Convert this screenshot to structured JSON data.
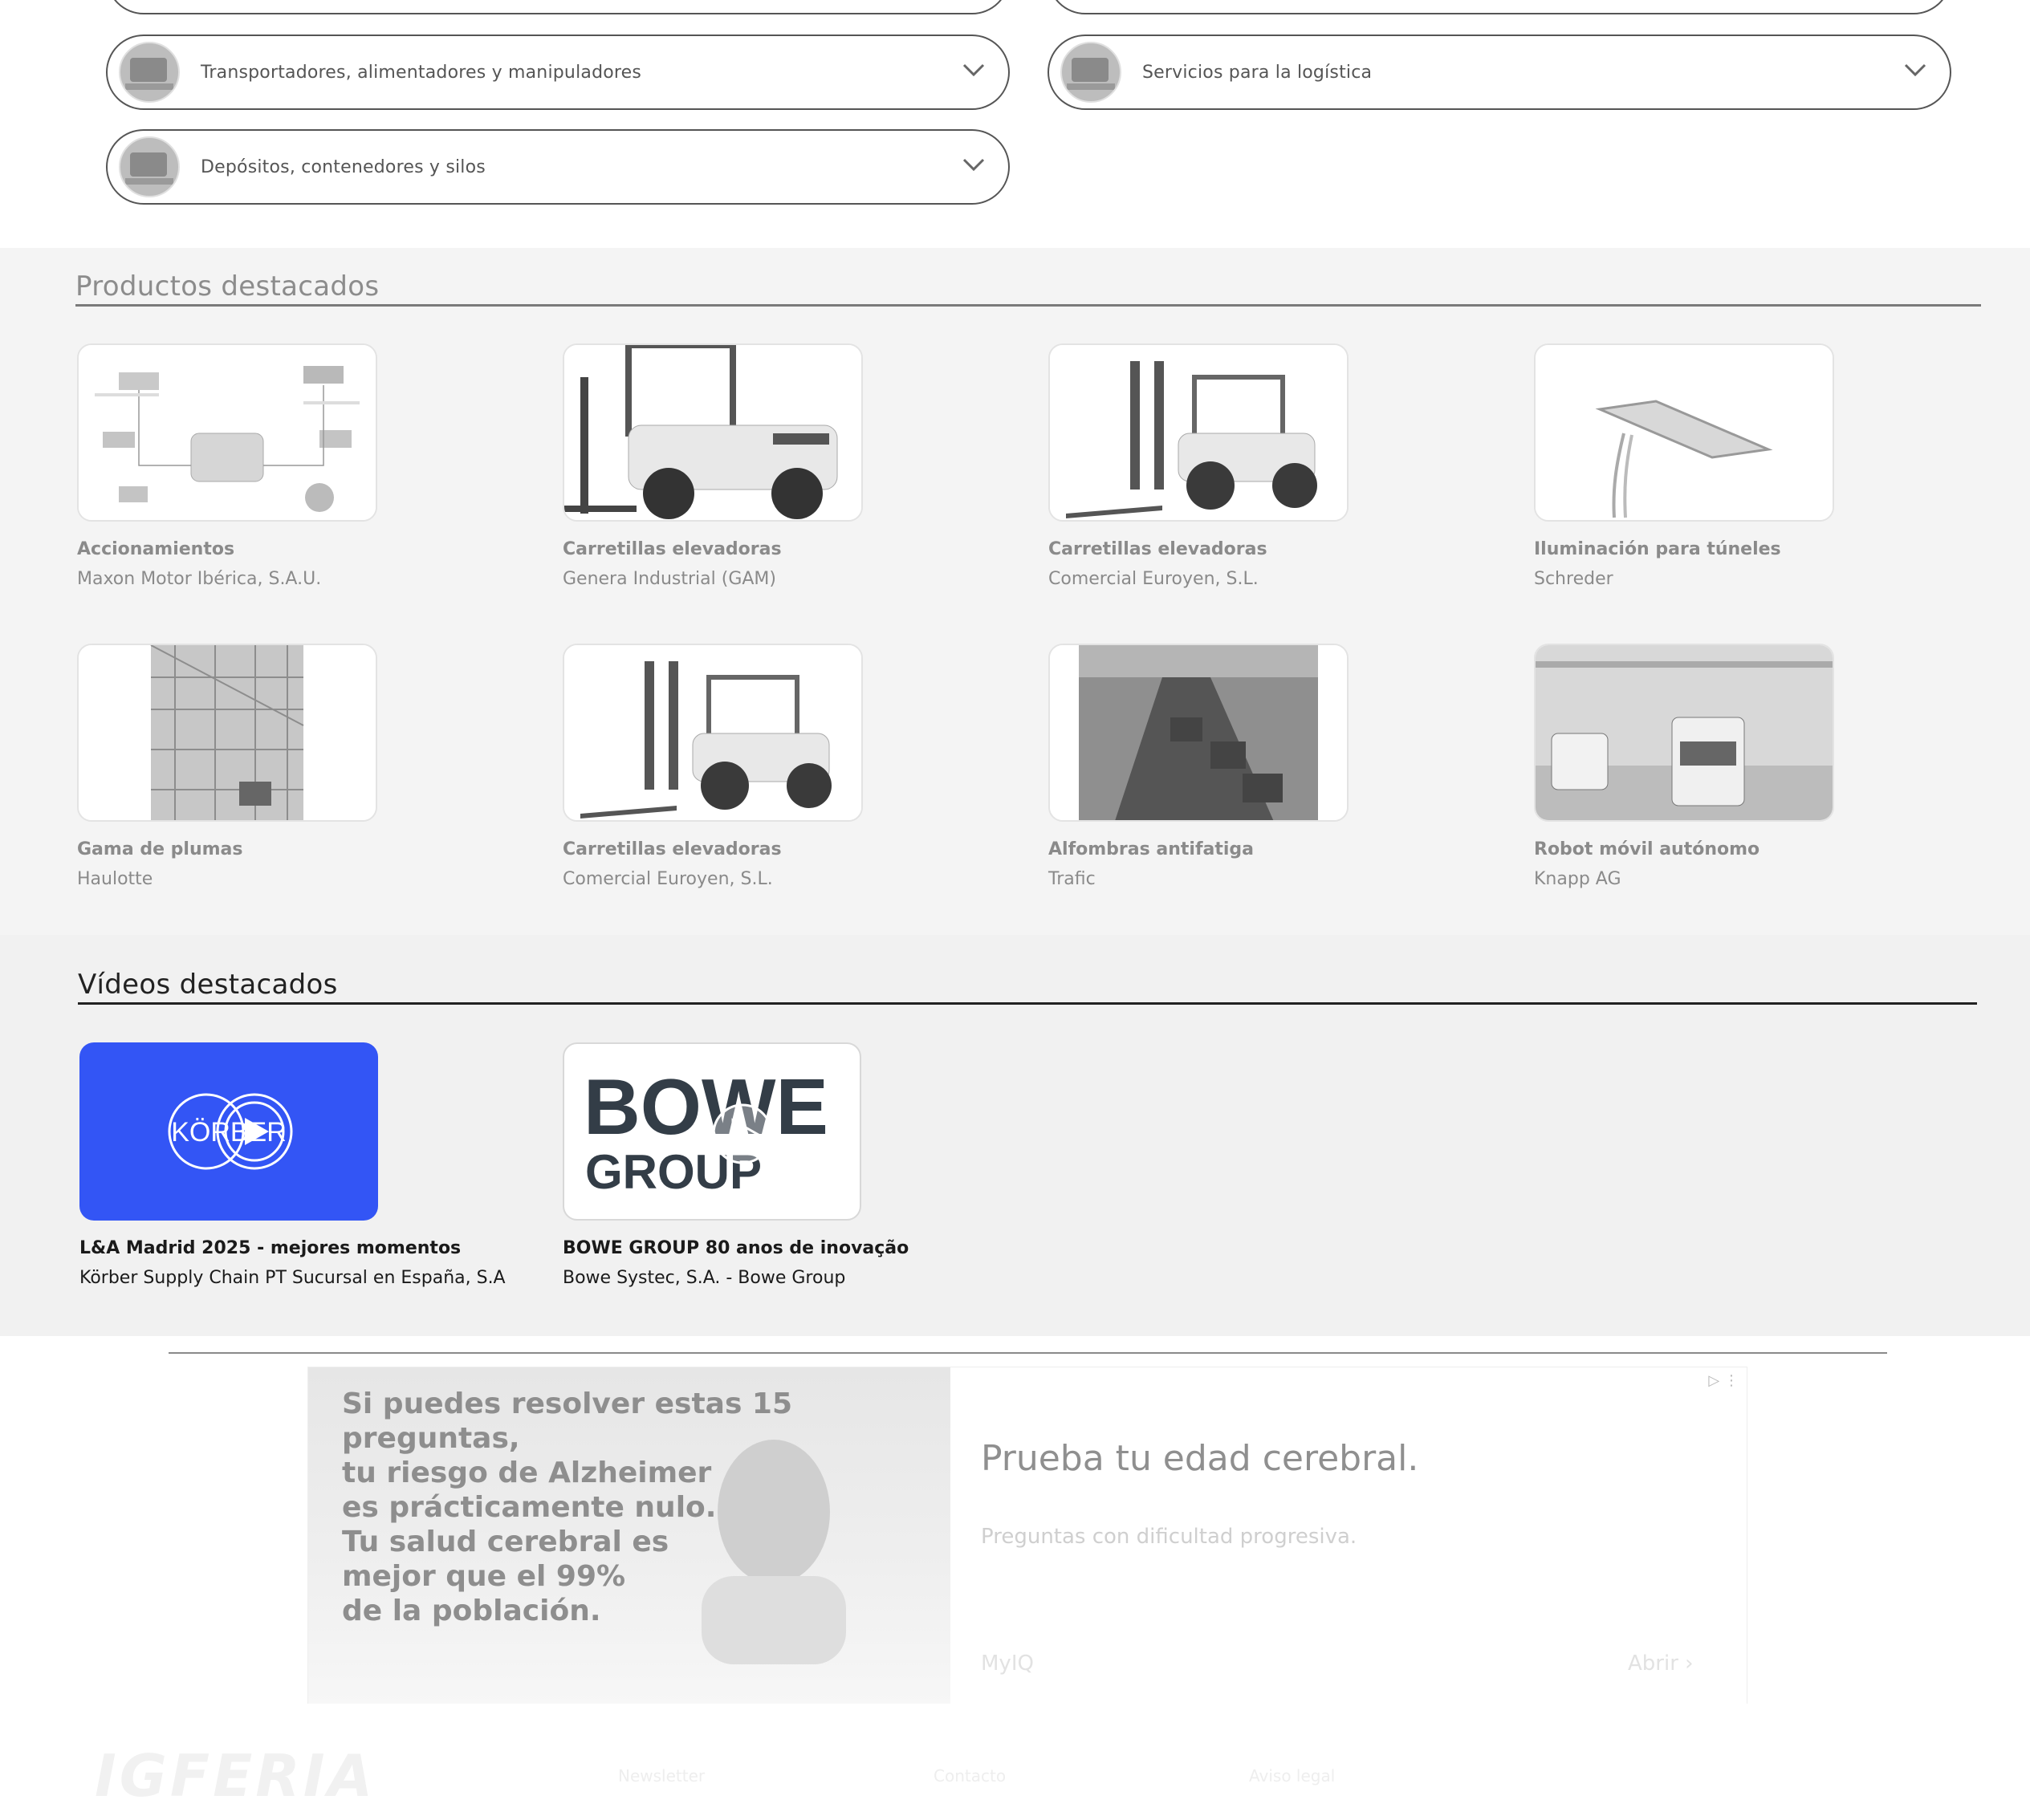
{
  "categories": [
    {
      "label": "Transportadores, alimentadores y manipuladores"
    },
    {
      "label": "Servicios para la logística"
    },
    {
      "label": "Depósitos, contenedores y silos"
    }
  ],
  "products": {
    "title": "Productos destacados",
    "items": [
      {
        "title": "Accionamientos",
        "company": "Maxon Motor Ibérica, S.A.U."
      },
      {
        "title": "Carretillas elevadoras",
        "company": "Genera Industrial (GAM)"
      },
      {
        "title": "Carretillas elevadoras",
        "company": "Comercial Euroyen, S.L."
      },
      {
        "title": "Iluminación para túneles",
        "company": "Schreder"
      },
      {
        "title": "Gama de plumas",
        "company": "Haulotte"
      },
      {
        "title": "Carretillas elevadoras",
        "company": "Comercial Euroyen, S.L."
      },
      {
        "title": "Alfombras antifatiga",
        "company": "Trafic"
      },
      {
        "title": "Robot móvil autónomo",
        "company": "Knapp AG"
      }
    ]
  },
  "videos": {
    "title": "Vídeos destacados",
    "items": [
      {
        "title": "L&A Madrid 2025 - mejores momentos",
        "company": "Körber Supply Chain PT Sucursal en España, S.A",
        "thumb_text": "KÖRBER",
        "thumb_color": "#3355f5"
      },
      {
        "title": "BOWE GROUP 80 anos de inovação",
        "company": "Bowe Systec, S.A. - Bowe Group",
        "thumb_text_1": "BOWE",
        "thumb_text_2": "GROUP",
        "thumb_color": "#333d47"
      }
    ]
  },
  "ad": {
    "headline_1": "Si puedes resolver estas 15 preguntas,",
    "headline_2": "tu riesgo de Alzheimer",
    "headline_3": "es prácticamente nulo.",
    "headline_4": "Tu salud cerebral es",
    "headline_5": "mejor que el 99%",
    "headline_6": "de la población.",
    "title": "Prueba tu edad cerebral.",
    "subtitle": "Preguntas con dificultad progresiva.",
    "brand": "MyIQ",
    "cta": "Abrir"
  },
  "footer": {
    "logo": "IGFERIA",
    "col1": "Newsletter",
    "col2": "Contacto",
    "col3": "Aviso legal"
  }
}
